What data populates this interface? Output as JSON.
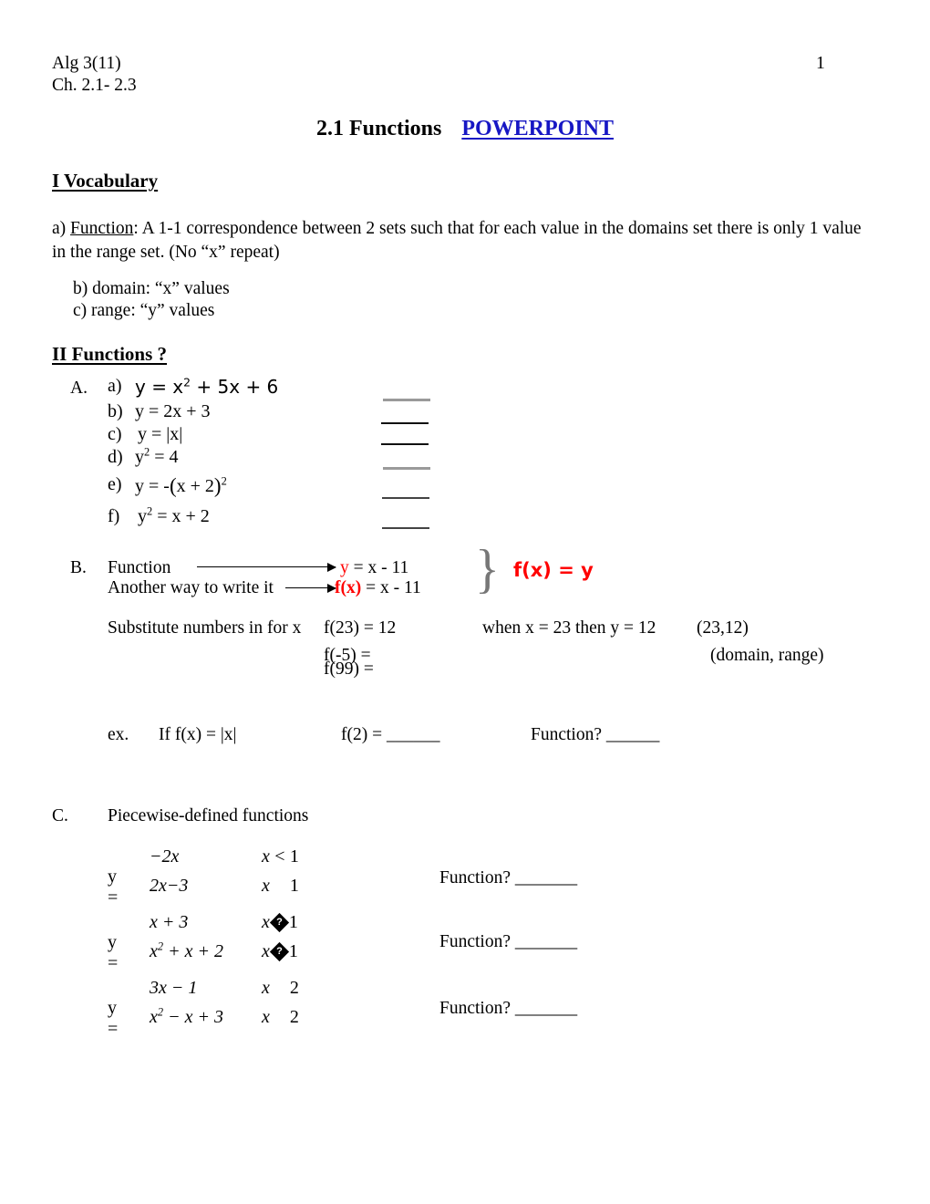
{
  "header": {
    "course": "Alg 3(11)",
    "chapter": "Ch. 2.1- 2.3",
    "page_number": "1"
  },
  "title": {
    "main": "2.1  Functions",
    "link": "POWERPOINT",
    "link_color": "#1717C4"
  },
  "sections": {
    "vocabulary": {
      "heading": "I  Vocabulary",
      "item_a_marker": "a)",
      "item_a_term": "Function",
      "item_a_text": ":  A 1-1 correspondence between 2 sets such that for each value in the domains set there is only 1 value in the range set.  (No “x” repeat)",
      "item_b": "b)  domain:  “x” values",
      "item_c": "c)  range:    “y” values"
    },
    "functions_q": {
      "heading": "II  Functions ?",
      "part_a": {
        "label": "A.",
        "items": [
          {
            "marker": "a)",
            "equation": "y = x² + 5x + 6",
            "blank": "_____"
          },
          {
            "marker": "b)",
            "equation": "y = 2x + 3",
            "blank": "_____"
          },
          {
            "marker": "c)",
            "equation": "y = |x|",
            "blank": "_____"
          },
          {
            "marker": "d)",
            "equation": "y² = 4",
            "blank": "_____"
          },
          {
            "marker": "e)",
            "equation": "y = -(x + 2)²",
            "blank": "_____"
          },
          {
            "marker": "f)",
            "equation": "y² = x + 2",
            "blank": "_____"
          }
        ]
      },
      "part_b": {
        "label": "B.",
        "row1_label": "Function",
        "row2_label": "Another way to write it",
        "row1_lhs": "y",
        "row1_rhs": "= x - 11",
        "row2_lhs": "f(x)",
        "row2_rhs": "= x - 11",
        "brace_note": "f(x)  =  y",
        "brace_note_color": "#FF0000",
        "substitute_label": "Substitute numbers in for x",
        "evaluations": [
          "f(23) = 12",
          "f(-5)  =",
          "f(99) ="
        ],
        "when_text": "when x = 23  then y = 12",
        "pair": "(23,12)",
        "pair_meaning": "(domain, range)",
        "example": {
          "marker": "ex.",
          "given": "If f(x) = |x|",
          "evaluate": "f(2) = ______",
          "question": "Function?  ______"
        }
      },
      "part_c": {
        "label": "C.",
        "heading": "Piecewise-defined functions",
        "pieces": [
          {
            "y_label": "y =",
            "line1_expr": "−2x",
            "line1_cond_var": "x",
            "line1_cond_op": "<",
            "line1_cond_val": "1",
            "line2_expr": "2x−3",
            "line2_cond_var": "x",
            "line2_cond_op": "",
            "line2_cond_val": "1",
            "question": "Function? _______"
          },
          {
            "y_label": "y =",
            "line1_expr": "x + 3",
            "line1_cond_var": "x",
            "line1_cond_op": "�",
            "line1_cond_val": "1",
            "line2_expr": "x² + x + 2",
            "line2_cond_var": "x",
            "line2_cond_op": "�",
            "line2_cond_val": "1",
            "question": "Function? _______"
          },
          {
            "y_label": "y =",
            "line1_expr": "3x − 1",
            "line1_cond_var": "x",
            "line1_cond_op": "",
            "line1_cond_val": "2",
            "line2_expr": "x² − x + 3",
            "line2_cond_var": "x",
            "line2_cond_op": "",
            "line2_cond_val": "2",
            "question": "Function? _______"
          }
        ]
      }
    }
  }
}
